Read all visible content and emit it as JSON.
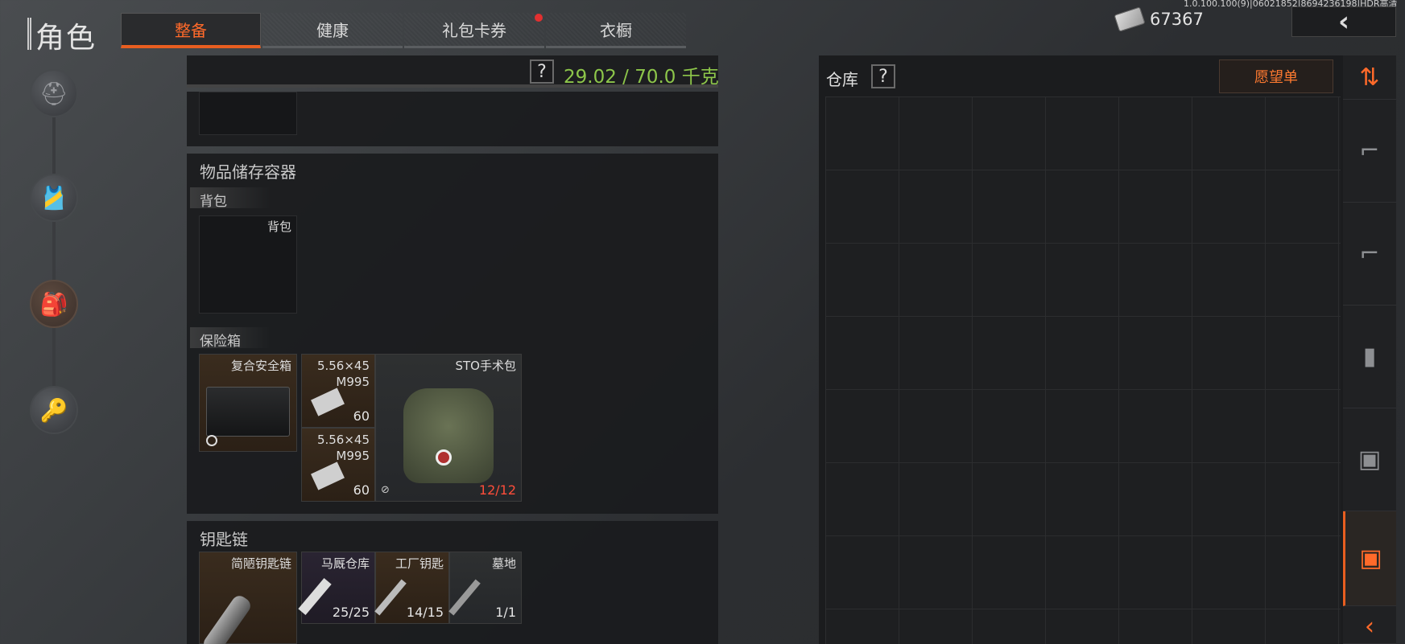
{
  "build": "1.0.100.100(9)|06021852|8694236198|HDR高清",
  "title": "角色",
  "tabs": [
    {
      "label": "整备",
      "active": true
    },
    {
      "label": "健康",
      "active": false
    },
    {
      "label": "礼包卡券",
      "active": false,
      "badge": true
    },
    {
      "label": "衣橱",
      "active": false
    }
  ],
  "currency": {
    "amount": "67367",
    "icon": "cash-stack-icon"
  },
  "back": {
    "icon": "chevron-left-icon",
    "glyph": "‹"
  },
  "left_nav": [
    {
      "name": "helmet-icon",
      "glyph": "⛑"
    },
    {
      "name": "rig-icon",
      "glyph": "🎽"
    },
    {
      "name": "backpack-icon",
      "glyph": "🎒",
      "active": true
    },
    {
      "name": "keys-icon",
      "glyph": "🔑"
    }
  ],
  "weight": {
    "help": "?",
    "value": "29.02 / 70.0 千克"
  },
  "storage_section": {
    "title": "物品储存容器",
    "backpack": {
      "label": "背包",
      "slot_label": "背包"
    },
    "safe": {
      "label": "保险箱",
      "container": {
        "name": "复合安全箱"
      },
      "items": [
        {
          "name": "5.56×45\nM995",
          "count": "60"
        },
        {
          "name": "5.56×45\nM995",
          "count": "60"
        },
        {
          "name": "STO手术包",
          "count": "12/12"
        }
      ]
    }
  },
  "keychain": {
    "title": "钥匙链",
    "container": {
      "name": "简陋钥匙链"
    },
    "keys": [
      {
        "name": "马厩仓库",
        "count": "25/25"
      },
      {
        "name": "工厂钥匙",
        "count": "14/15"
      },
      {
        "name": "墓地",
        "count": "1/1"
      }
    ]
  },
  "warehouse": {
    "title": "仓库",
    "help": "?",
    "wishlist": "愿望单"
  },
  "side_tabs": [
    {
      "name": "sort-icon",
      "glyph": "⇅"
    },
    {
      "name": "rifle-icon",
      "glyph": "⌐"
    },
    {
      "name": "rifle-icon-2",
      "glyph": "⌐"
    },
    {
      "name": "magazine-icon",
      "glyph": "▮"
    },
    {
      "name": "box-icon",
      "glyph": "▣"
    },
    {
      "name": "cube-active-icon",
      "glyph": "▣",
      "active": true
    },
    {
      "name": "chevron-left-icon",
      "glyph": "‹"
    }
  ],
  "colors": {
    "accent": "#ff6a2a",
    "weight": "#8dc64a",
    "count_warn": "#ff4d3a"
  }
}
